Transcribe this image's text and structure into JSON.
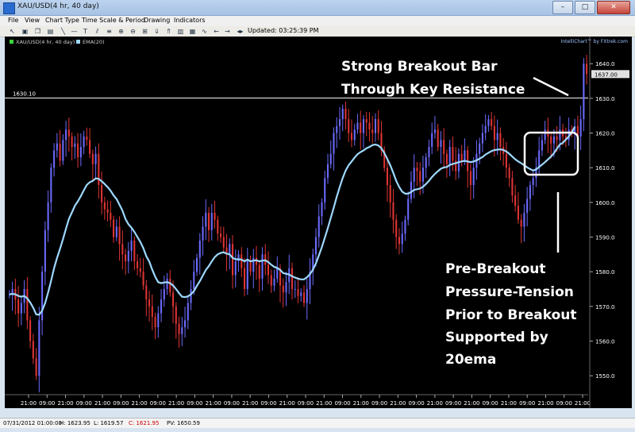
{
  "window": {
    "title": "XAU/USD(4 hr,  40 day)",
    "controls": [
      "–",
      "□",
      "✕"
    ]
  },
  "menu": [
    "File",
    "View",
    "Chart Type",
    "Time Scale & Period",
    "Drawing",
    "Indicators"
  ],
  "toolbar": {
    "icons": [
      "cursor-icon",
      "zoom-box-icon",
      "copy-icon",
      "print-icon",
      "line-tool-icon",
      "hline-tool-icon",
      "text-tool-icon",
      "channel-tool-icon",
      "fib-tool-icon",
      "zoom-in-icon",
      "zoom-out-icon",
      "fit-icon",
      "down-icon",
      "up-icon",
      "chart-icon",
      "grid-icon",
      "wave-icon",
      "left-icon",
      "right-icon",
      "prev-icon",
      "next-icon"
    ],
    "updated": "Updated: 03:25:39 PM"
  },
  "chart": {
    "legend_symbol": "XAU/USD(4 hr,  40 day)",
    "legend_ema": "EMA(20)",
    "brand": "IntelliChart™ by FXtrek.com",
    "hline_label": "1630.10",
    "last_price": "1637.00"
  },
  "annotations": {
    "breakout_line1": "Strong Breakout Bar",
    "breakout_line2": "Through Key Resistance",
    "pressure_line1": "Pre-Breakout",
    "pressure_line2": "Pressure-Tension",
    "pressure_line3": "Prior to Breakout",
    "pressure_line4": "Supported by",
    "pressure_line5": "20ema"
  },
  "status": {
    "date": "07/31/2012 01:00:00",
    "high": "H: 1623.95",
    "low": "L: 1619.57",
    "close": "C: 1621.95",
    "pv": "PV: 1650.59"
  },
  "colors": {
    "up": "#6b6bff",
    "down": "#e03434",
    "ema": "#9ed8ff",
    "background": "#000000",
    "resistance": "#ffffff"
  },
  "chart_data": {
    "type": "candlestick",
    "symbol": "XAU/USD",
    "timeframe": "4 hr",
    "ylim": [
      1545,
      1646
    ],
    "yticks": [
      1550,
      1560,
      1570,
      1580,
      1590,
      1600,
      1610,
      1620,
      1630,
      1640
    ],
    "xticks": [
      "21:00",
      "09:00",
      "21:00",
      "09:00",
      "21:00",
      "09:00",
      "21:00",
      "09:00",
      "21:00",
      "09:00",
      "21:00",
      "09:00",
      "21:00",
      "09:00",
      "21:00",
      "09:00",
      "21:00",
      "09:00",
      "21:00",
      "09:00",
      "21:00",
      "09:00",
      "21:00",
      "09:00",
      "21:00",
      "09:00",
      "21:00",
      "09:00",
      "21:00",
      "09:00",
      "21:00"
    ],
    "resistance": 1630.1,
    "series": [
      {
        "name": "XAU/USD(4 hr,  40 day)",
        "close": [
          1573.5,
          1575,
          1572,
          1568,
          1571,
          1575,
          1566,
          1560,
          1555,
          1550,
          1566,
          1580,
          1592,
          1600,
          1610,
          1615,
          1617,
          1612,
          1618,
          1621,
          1619,
          1616,
          1617,
          1613,
          1616,
          1619,
          1618,
          1614,
          1611,
          1614,
          1605,
          1600,
          1598,
          1597,
          1595,
          1590,
          1593,
          1588,
          1585,
          1583,
          1586,
          1589,
          1583,
          1581,
          1580,
          1576,
          1572,
          1570,
          1567,
          1564,
          1568,
          1572,
          1575,
          1578,
          1574,
          1570,
          1565,
          1562,
          1564,
          1566,
          1571,
          1575,
          1580,
          1584,
          1589,
          1593,
          1597,
          1592,
          1597,
          1595,
          1591,
          1590,
          1587,
          1585,
          1588,
          1579,
          1583,
          1585,
          1581,
          1575,
          1583,
          1580,
          1584,
          1582,
          1578,
          1585,
          1582,
          1579,
          1576,
          1578,
          1581,
          1576,
          1574,
          1577,
          1581,
          1575,
          1575,
          1573,
          1574,
          1571,
          1575,
          1580,
          1585,
          1590,
          1596,
          1600,
          1607,
          1611,
          1614,
          1620,
          1622,
          1624,
          1627,
          1624,
          1620,
          1618,
          1621,
          1623,
          1620,
          1624,
          1623,
          1621,
          1620,
          1624,
          1620,
          1615,
          1610,
          1605,
          1600,
          1595,
          1590,
          1588,
          1591,
          1595,
          1601,
          1606,
          1610,
          1609,
          1606,
          1610,
          1613,
          1616,
          1620,
          1621,
          1616,
          1618,
          1614,
          1611,
          1616,
          1612,
          1609,
          1614,
          1612,
          1615,
          1609,
          1605,
          1610,
          1614,
          1617,
          1620,
          1622,
          1624,
          1622,
          1618,
          1620,
          1616,
          1614,
          1610,
          1607,
          1602,
          1599,
          1595,
          1593,
          1597,
          1601,
          1605,
          1607,
          1610,
          1615,
          1618,
          1621,
          1619,
          1617,
          1619,
          1618,
          1621,
          1619,
          1618,
          1621,
          1620,
          1622,
          1619,
          1624,
          1640,
          1637
        ],
        "ema20": [
          1573.5,
          1573.6,
          1573.5,
          1573,
          1572.8,
          1573,
          1572.3,
          1571.1,
          1569.6,
          1567.7,
          1567.6,
          1568.8,
          1571,
          1574,
          1577.4,
          1581,
          1584,
          1586.6,
          1589.4,
          1592.4,
          1595.2,
          1597.1,
          1599,
          1600.3,
          1601.8,
          1603.5,
          1605,
          1605.8,
          1606.2,
          1606.9,
          1606.8,
          1606.1,
          1605.3,
          1604.4,
          1603.4,
          1602,
          1601,
          1599.3,
          1597.6,
          1595.2,
          1593.7,
          1592.7,
          1591.5,
          1590,
          1588.6,
          1586.8,
          1584.5,
          1582.9,
          1580.6,
          1578.5,
          1577,
          1576.7,
          1576.9,
          1577,
          1576.7,
          1576,
          1575,
          1573.8,
          1572.8,
          1572.7,
          1572.9,
          1573.5,
          1574.4,
          1575.9,
          1577.3,
          1578.9,
          1580.5,
          1581.6,
          1583,
          1584.2,
          1585,
          1585.4,
          1585.6,
          1585.2,
          1585,
          1584,
          1583.6,
          1583.6,
          1583.5,
          1583,
          1583.5,
          1583,
          1583.2,
          1583.3,
          1583,
          1583.2,
          1583.3,
          1582.8,
          1582,
          1581.4,
          1581.1,
          1580.5,
          1579.6,
          1579.4,
          1579.2,
          1578.7,
          1578.3,
          1578,
          1577.8,
          1577.8,
          1578.4,
          1579.3,
          1580.6,
          1582.4,
          1584.7,
          1587.1,
          1589.8,
          1592.6,
          1595.5,
          1598.5,
          1601.6,
          1604.4,
          1607,
          1609.2,
          1610.7,
          1611.8,
          1612.9,
          1613.9,
          1614.5,
          1615,
          1615.6,
          1616,
          1616.5,
          1616.7,
          1616.4,
          1615.6,
          1614.2,
          1612.5,
          1610.7,
          1608.5,
          1606.2,
          1604.4,
          1603.1,
          1602.5,
          1602.5,
          1603,
          1603.6,
          1603.8,
          1604,
          1604.5,
          1605.3,
          1606.2,
          1607.3,
          1608.2,
          1609,
          1609.7,
          1610.1,
          1610.2,
          1610.8,
          1611.1,
          1611.3,
          1611.6,
          1611.8,
          1612,
          1611.8,
          1611.6,
          1611.8,
          1612.1,
          1612.6,
          1613.1,
          1613.8,
          1614.3,
          1614.8,
          1615.1,
          1615.2,
          1615.3,
          1615.1,
          1614.7,
          1614,
          1613.2,
          1612.4,
          1611.8,
          1611.3,
          1610.7,
          1610.1,
          1609.6,
          1609.2,
          1609.5,
          1610.2,
          1610.9,
          1611.6,
          1612.4,
          1613.2,
          1614.2,
          1615.5,
          1616.7,
          1617.2,
          1618.1,
          1619,
          1620.2,
          1621.8
        ]
      }
    ]
  }
}
